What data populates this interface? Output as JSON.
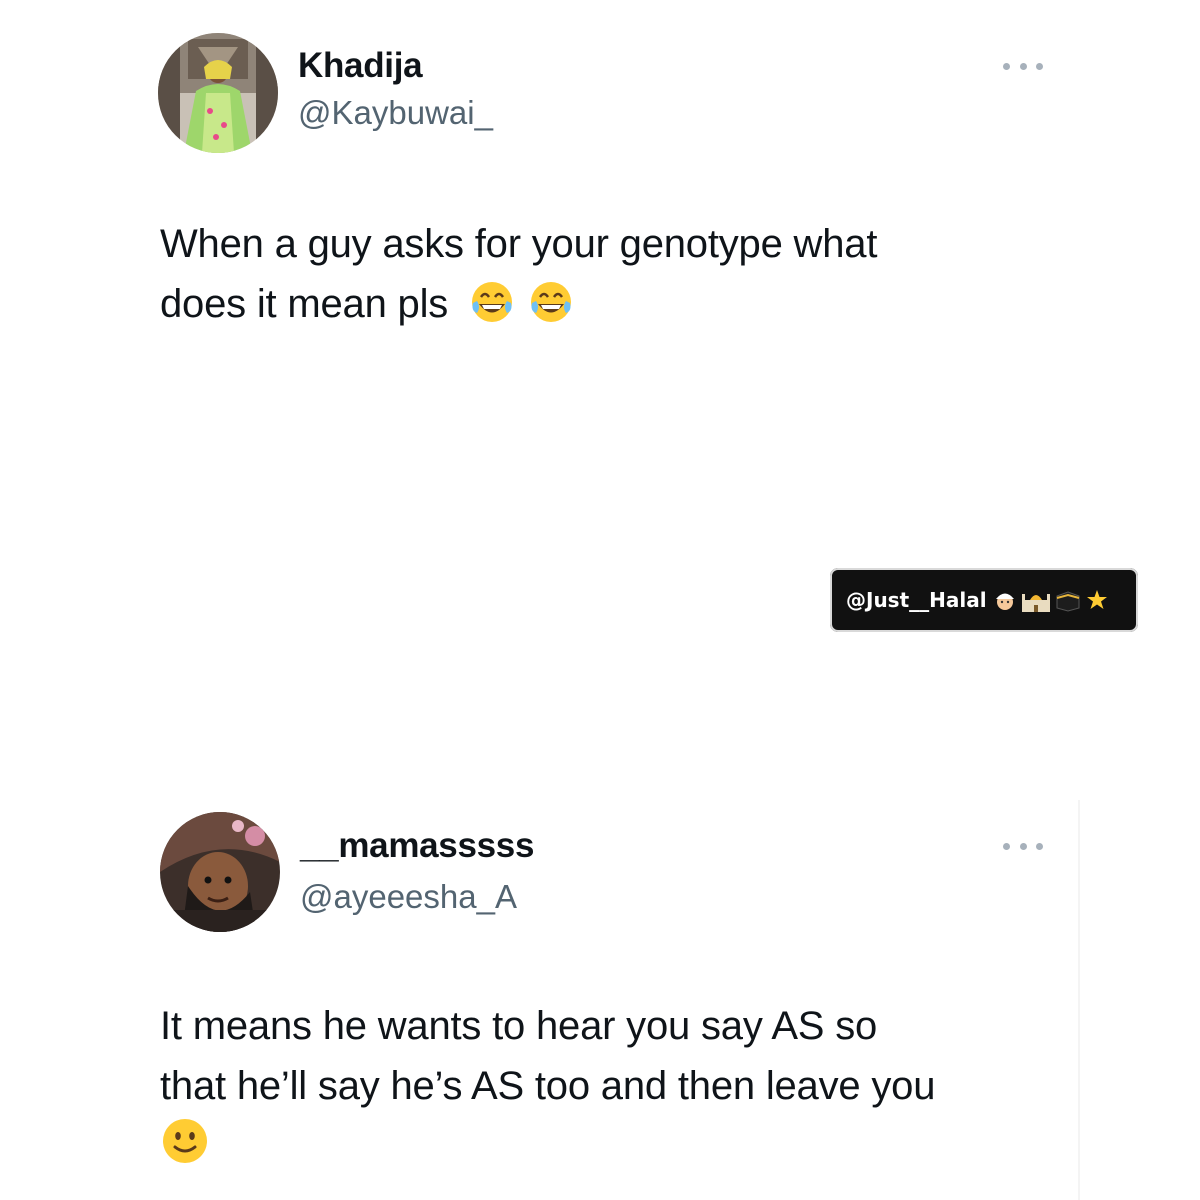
{
  "tweets": [
    {
      "display_name": "Khadija",
      "handle": "@Kaybuwai_",
      "text_lines": [
        "When a guy asks for your genotype what",
        "does it mean pls"
      ],
      "emojis": [
        "face-with-tears-of-joy",
        "face-with-tears-of-joy"
      ],
      "avatar": "avatar-woman-green-outfit"
    },
    {
      "display_name": "__mamasssss",
      "handle": "@ayeeesha_A",
      "text_lines": [
        "It means he wants to hear you say AS so",
        "that he’ll say he’s AS too and then leave you"
      ],
      "emojis": [
        "slightly-smiling-face"
      ],
      "avatar": "avatar-selfie-upside-down"
    }
  ],
  "watermark": {
    "text": "@Just__Halal",
    "icons": [
      "man-with-turban-icon",
      "mosque-icon",
      "kaaba-icon",
      "sparkle-star-icon"
    ]
  },
  "colors": {
    "text": "#0f1419",
    "secondary": "#536471",
    "dots": "#a7b1bb",
    "emoji_yellow": "#ffcc33"
  }
}
